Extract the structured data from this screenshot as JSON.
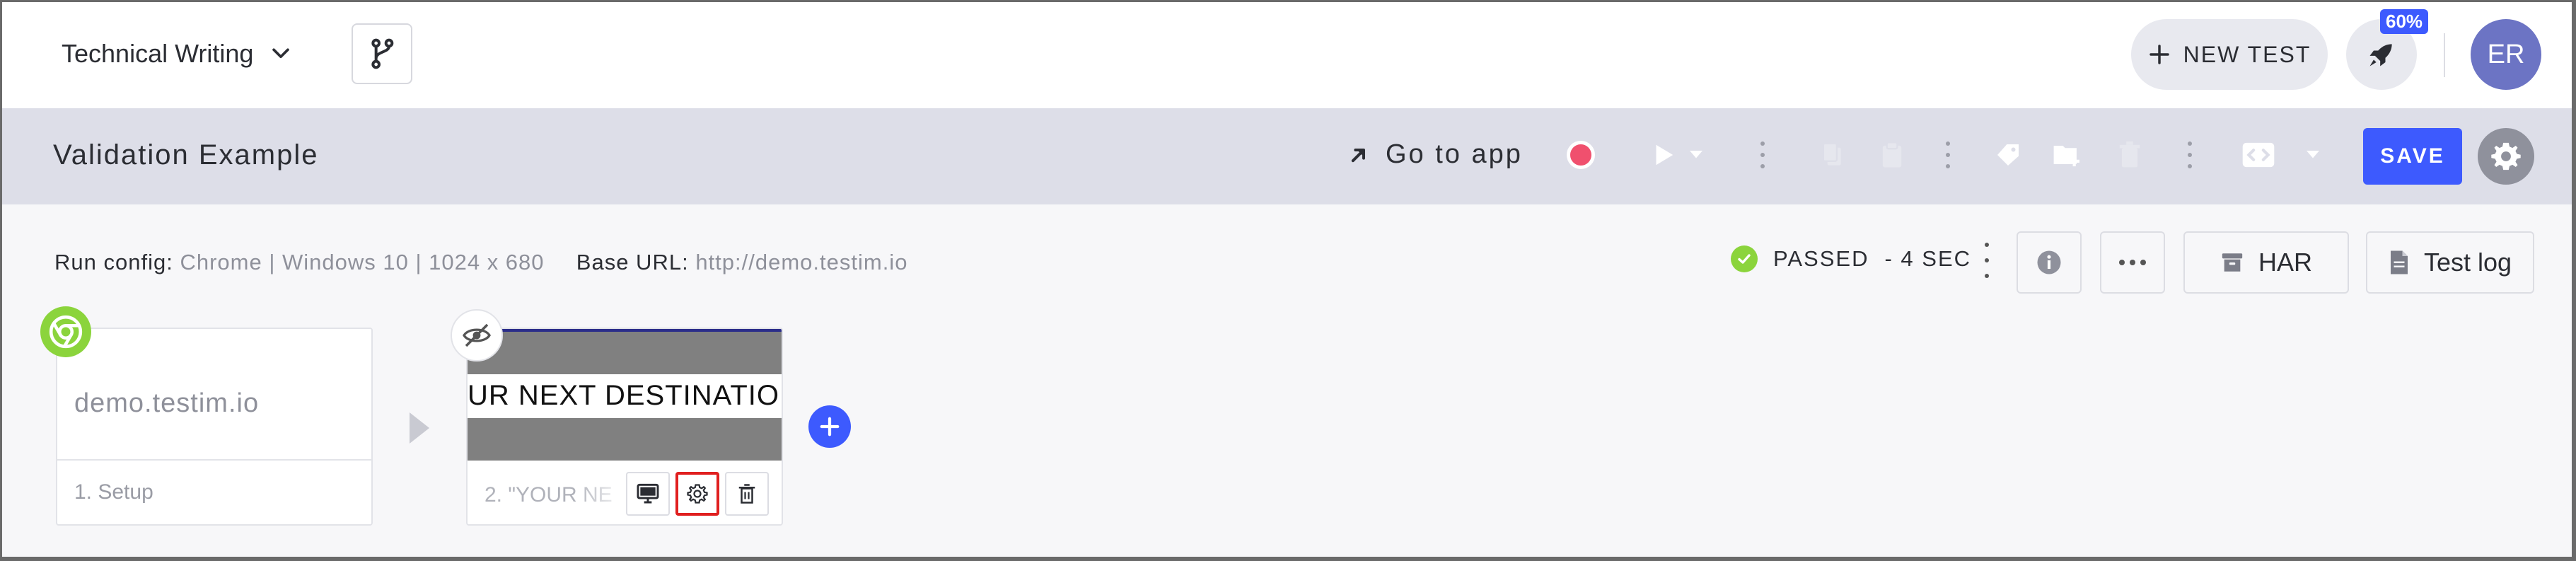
{
  "topbar": {
    "project_name": "Technical Writing",
    "new_test_label": "NEW TEST",
    "notification_badge": "60%",
    "avatar_initials": "ER"
  },
  "testbar": {
    "test_name": "Validation Example",
    "go_to_app_label": "Go to app",
    "save_label": "SAVE"
  },
  "info": {
    "run_config_label": "Run config:",
    "run_config_value": "Chrome | Windows 10 | 1024 x 680",
    "base_url_label": "Base URL:",
    "base_url_value": "http://demo.testim.io",
    "status_text": "PASSED",
    "duration_text": "- 4 SEC",
    "har_label": "HAR",
    "test_log_label": "Test log"
  },
  "steps": [
    {
      "title": "demo.testim.io",
      "label": "1. Setup"
    },
    {
      "screenshot_text": "UR NEXT DESTINATIO",
      "label": "2. \"YOUR NE"
    }
  ],
  "colors": {
    "accent": "#3d5afe",
    "passed": "#8bd43c",
    "record": "#f0506e",
    "highlight": "#e01f1f"
  }
}
